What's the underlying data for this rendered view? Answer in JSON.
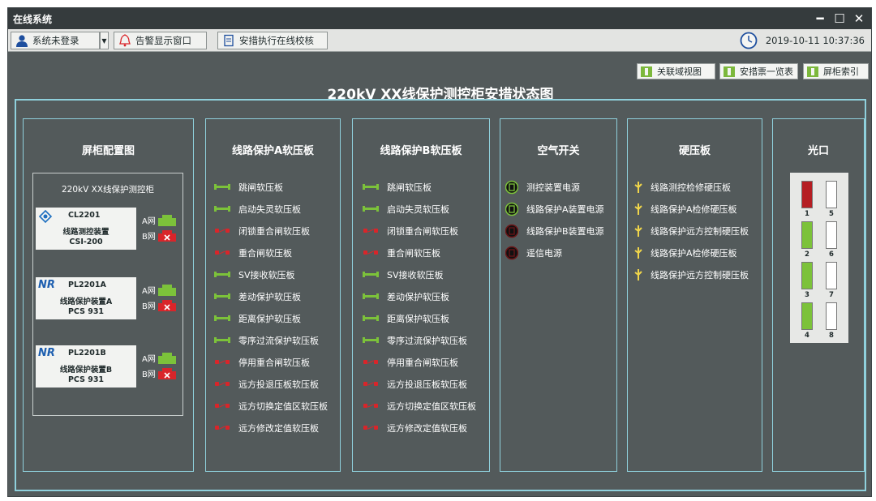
{
  "window": {
    "title": "在线系统",
    "minimize": "━",
    "maximize": "☐",
    "close": "✕"
  },
  "toolbar": {
    "login_label": "系统未登录",
    "alarm_label": "告警显示窗口",
    "check_label": "安措执行在线校核",
    "datetime": "2019-10-11 10:37:36"
  },
  "links": {
    "related_view": "关联域视图",
    "measure_list": "安措票一览表",
    "cabinet_index": "屏柜索引"
  },
  "page_title": "220kV XX线保护测控柜安措状态图",
  "panels": {
    "cabinet": {
      "title": "屏柜配置图",
      "box_title": "220kV XX线保护测控柜",
      "devices": [
        {
          "name": "CL2201",
          "desc": "线路测控装置",
          "model": "CSI-200",
          "net_a": "A网",
          "net_b": "B网",
          "net_a_ok": true,
          "net_b_ok": false
        },
        {
          "name": "PL2201A",
          "desc": "线路保护装置A",
          "model": "PCS 931",
          "net_a": "A网",
          "net_b": "B网",
          "net_a_ok": true,
          "net_b_ok": false
        },
        {
          "name": "PL2201B",
          "desc": "线路保护装置B",
          "model": "PCS 931",
          "net_a": "A网",
          "net_b": "B网",
          "net_a_ok": true,
          "net_b_ok": false
        }
      ],
      "logo_text": "NR"
    },
    "soft_a": {
      "title": "线路保护A软压板",
      "items": [
        {
          "label": "跳闸软压板",
          "on": true
        },
        {
          "label": "启动失灵软压板",
          "on": true
        },
        {
          "label": "闭锁重合闸软压板",
          "on": false
        },
        {
          "label": "重合闸软压板",
          "on": false
        },
        {
          "label": "SV接收软压板",
          "on": true
        },
        {
          "label": "差动保护软压板",
          "on": true
        },
        {
          "label": "距离保护软压板",
          "on": true
        },
        {
          "label": "零序过流保护软压板",
          "on": true
        },
        {
          "label": "停用重合闸软压板",
          "on": false
        },
        {
          "label": "远方投退压板软压板",
          "on": false
        },
        {
          "label": "远方切换定值区软压板",
          "on": false
        },
        {
          "label": "远方修改定值软压板",
          "on": false
        }
      ]
    },
    "soft_b": {
      "title": "线路保护B软压板",
      "items": [
        {
          "label": "跳闸软压板",
          "on": true
        },
        {
          "label": "启动失灵软压板",
          "on": true
        },
        {
          "label": "闭锁重合闸软压板",
          "on": false
        },
        {
          "label": "重合闸软压板",
          "on": false
        },
        {
          "label": "SV接收软压板",
          "on": true
        },
        {
          "label": "差动保护软压板",
          "on": true
        },
        {
          "label": "距离保护软压板",
          "on": true
        },
        {
          "label": "零序过流保护软压板",
          "on": true
        },
        {
          "label": "停用重合闸软压板",
          "on": false
        },
        {
          "label": "远方投退压板软压板",
          "on": false
        },
        {
          "label": "远方切换定值区软压板",
          "on": false
        },
        {
          "label": "远方修改定值软压板",
          "on": false
        }
      ]
    },
    "air": {
      "title": "空气开关",
      "items": [
        {
          "label": "测控装置电源",
          "on": true
        },
        {
          "label": "线路保护A装置电源",
          "on": true
        },
        {
          "label": "线路保护B装置电源",
          "on": false
        },
        {
          "label": "遥信电源",
          "on": false
        }
      ]
    },
    "hard": {
      "title": "硬压板",
      "items": [
        {
          "label": "线路测控检修硬压板"
        },
        {
          "label": "线路保护A检修硬压板"
        },
        {
          "label": "线路保护远方控制硬压板"
        },
        {
          "label": "线路保护A检修硬压板"
        },
        {
          "label": "线路保护远方控制硬压板"
        }
      ]
    },
    "optical": {
      "title": "光口",
      "ports": [
        {
          "num": "1",
          "state": "alarm"
        },
        {
          "num": "2",
          "state": "ok"
        },
        {
          "num": "3",
          "state": "ok"
        },
        {
          "num": "4",
          "state": "ok"
        },
        {
          "num": "5",
          "state": "empty"
        },
        {
          "num": "6",
          "state": "empty"
        },
        {
          "num": "7",
          "state": "empty"
        },
        {
          "num": "8",
          "state": "empty"
        }
      ]
    }
  },
  "colors": {
    "on": "#7cc23a",
    "off": "#d9252a",
    "accent": "#8fd0dc",
    "alarm": "#b51e23"
  }
}
